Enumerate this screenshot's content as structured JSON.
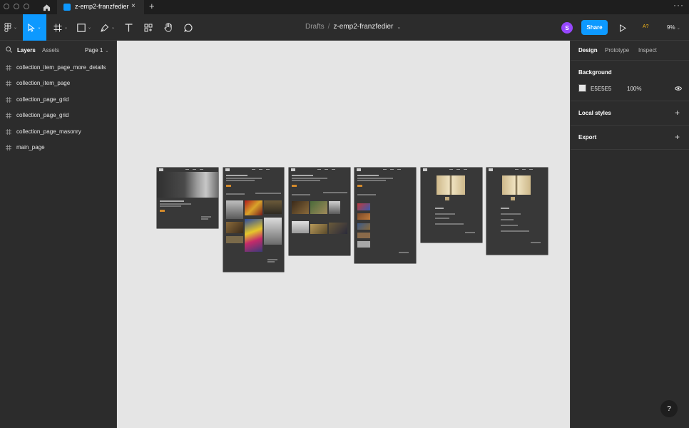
{
  "tabbar": {
    "file_tab_title": "z-emp2-franzfedier",
    "close_glyph": "×",
    "new_tab_glyph": "+",
    "menu_glyph": "···"
  },
  "toolbar": {
    "breadcrumb_drafts": "Drafts",
    "breadcrumb_sep": "/",
    "file_name": "z-emp2-franzfedier",
    "avatar_initial": "S",
    "share_label": "Share",
    "a11y_label": "A?",
    "zoom_label": "9%",
    "caret": "⌄"
  },
  "left_panel": {
    "tab_layers": "Layers",
    "tab_assets": "Assets",
    "page_label": "Page 1",
    "layers": [
      "collection_item_page_more_details",
      "collection_item_page",
      "collection_page_grid",
      "collection_page_grid",
      "collection_page_masonry",
      "main_page"
    ]
  },
  "right_panel": {
    "tab_design": "Design",
    "tab_prototype": "Prototype",
    "tab_inspect": "Inspect",
    "background_title": "Background",
    "background_hex": "E5E5E5",
    "background_opacity": "100%",
    "local_styles_title": "Local styles",
    "export_title": "Export",
    "plus_glyph": "+"
  },
  "help_label": "?",
  "colors": {
    "accent": "#0d99ff",
    "avatar": "#9747ff",
    "canvas": "#e5e5e5",
    "panel": "#2c2c2c",
    "topbar": "#1e1e1e",
    "frame": "#383838",
    "frame_accent": "#d38a2c"
  }
}
